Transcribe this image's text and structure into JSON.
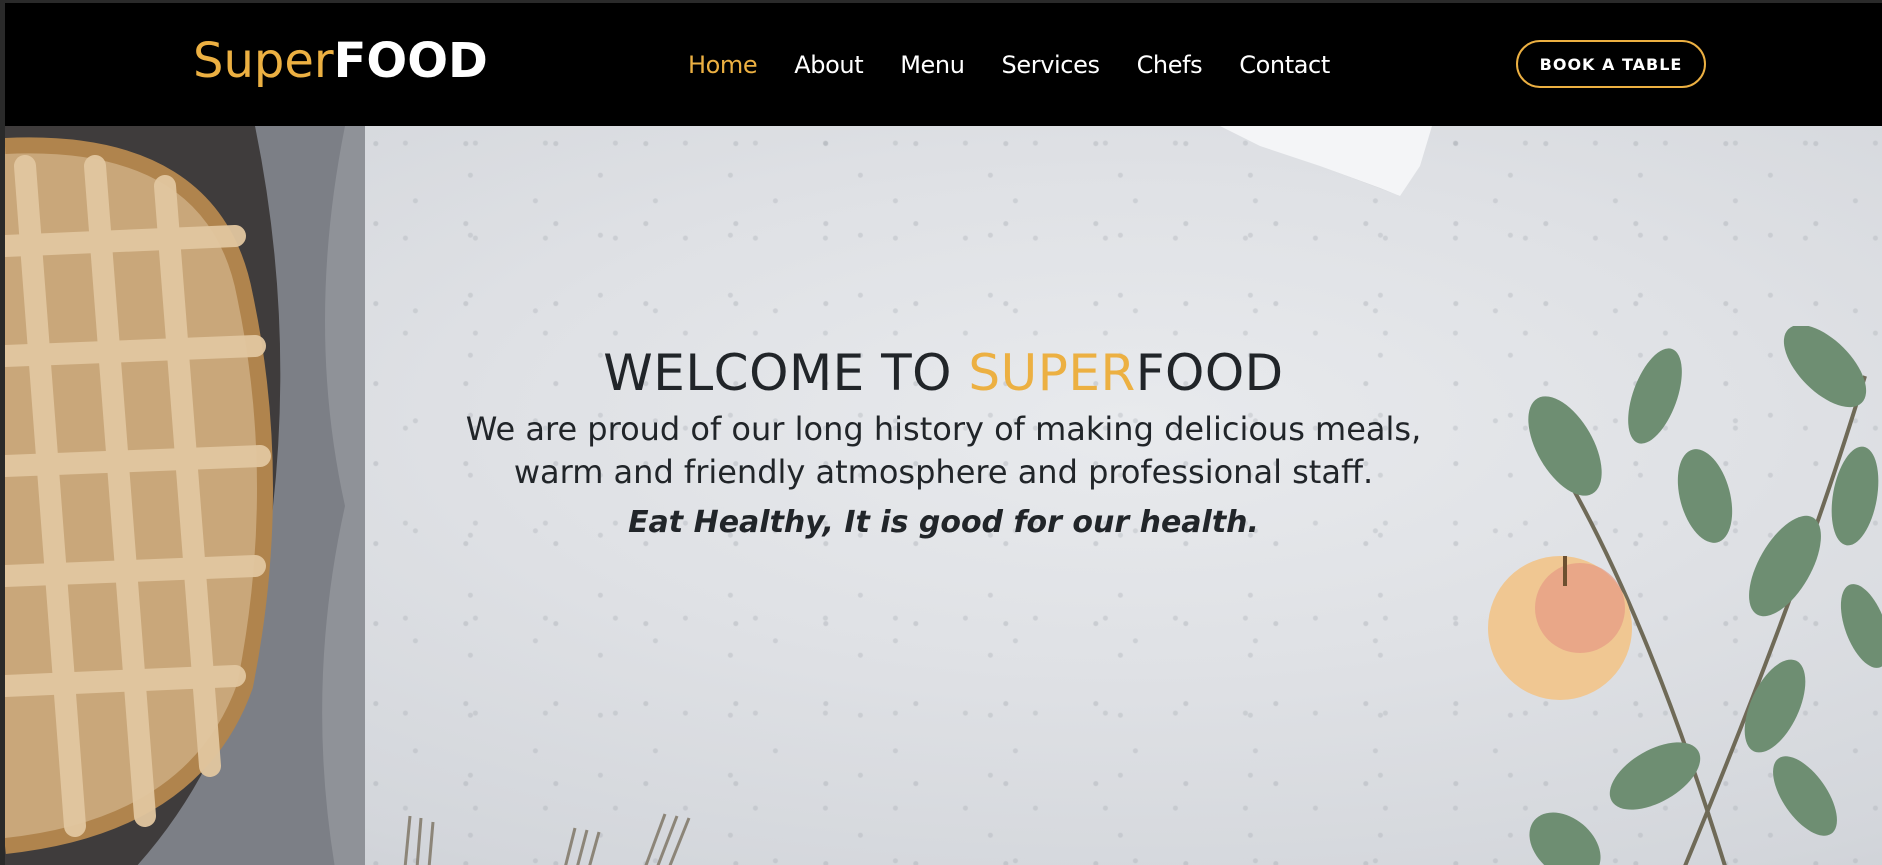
{
  "brand": {
    "part1": "Super",
    "part2": "FOOD"
  },
  "nav": {
    "items": [
      {
        "label": "Home",
        "active": true
      },
      {
        "label": "About",
        "active": false
      },
      {
        "label": "Menu",
        "active": false
      },
      {
        "label": "Services",
        "active": false
      },
      {
        "label": "Chefs",
        "active": false
      },
      {
        "label": "Contact",
        "active": false
      }
    ]
  },
  "cta": {
    "label": "BOOK A TABLE"
  },
  "hero": {
    "title_prefix": "WELCOME TO ",
    "title_highlight": "SUPER",
    "title_suffix": "FOOD",
    "description": "We are proud of our long history of making delicious meals, warm and friendly atmosphere and professional staff.",
    "tagline": "Eat Healthy, It is good for our health."
  },
  "colors": {
    "accent": "#ecb042",
    "header_bg": "#000000",
    "text_dark": "#212529"
  },
  "images": {
    "pie": "lattice-pie-image",
    "cloth": "napkin-image",
    "plant": "eucalyptus-apple-image",
    "forks": "forks-image"
  }
}
